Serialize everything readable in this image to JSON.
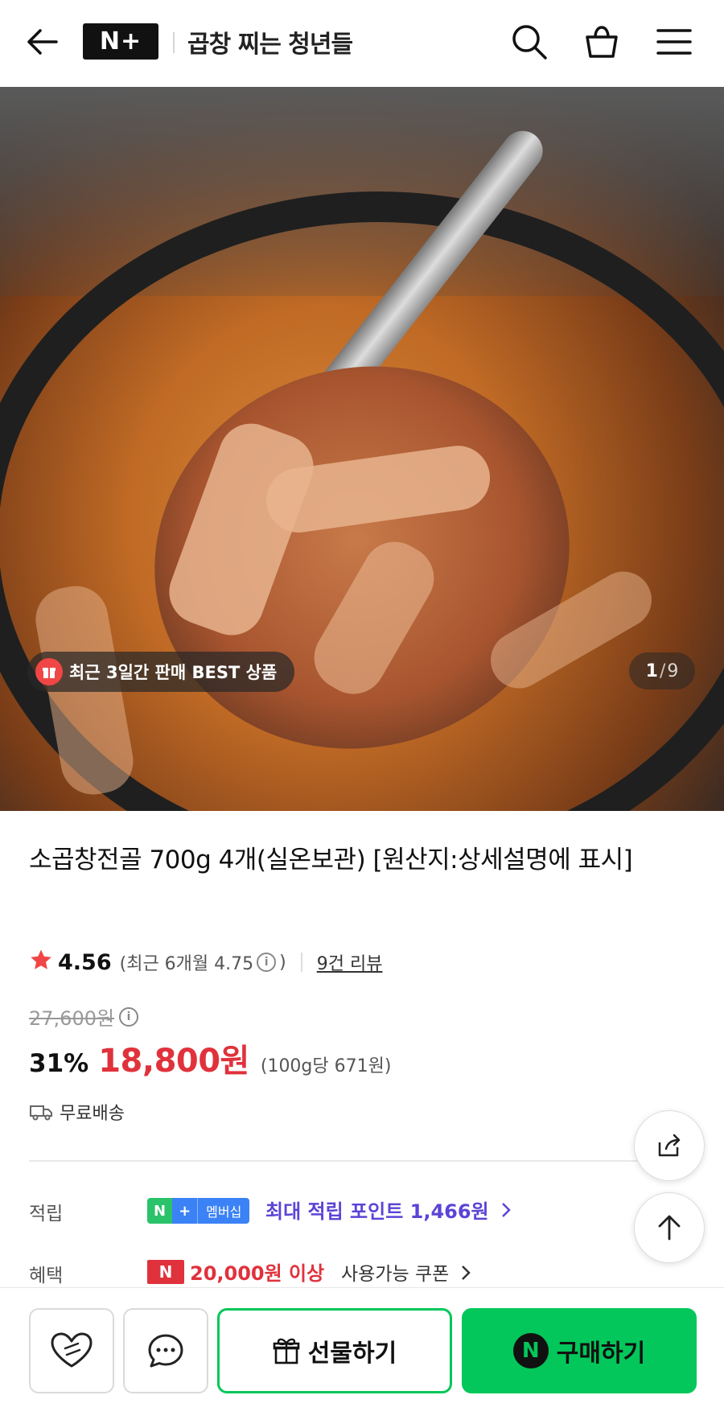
{
  "header": {
    "logo_text": "N+",
    "store_name": "곱창 찌는 청년들",
    "icons": [
      "back-arrow-icon",
      "search-icon",
      "cart-icon",
      "menu-icon"
    ]
  },
  "hero": {
    "badge_text": "최근 3일간 판매 BEST 상품",
    "current_index": "1",
    "separator": "/",
    "total": "9"
  },
  "product": {
    "title": "소곱창전골 700g 4개(실온보관) [원산지:상세설명에 표시]",
    "rating": "4.56",
    "recent_rating": "(최근 6개월 4.75",
    "recent_rating_close": ")",
    "review_link": "9건 리뷰",
    "original_price": "27,600원",
    "discount": "31%",
    "sale_price": "18,800원",
    "unit_price": "(100g당 671원)",
    "shipping": "무료배송"
  },
  "benefits": {
    "points_label": "적립",
    "badge_n": "N",
    "badge_plus": "+",
    "badge_member": "멤버십",
    "max_points": "최대 적립 포인트 1,466원",
    "benefit_label": "혜택",
    "coupon_mark": "N",
    "coupon_amount": "20,000원 이상",
    "coupon_rest": "사용가능 쿠폰"
  },
  "bottom": {
    "gift_label": "선물하기",
    "buy_label": "구매하기",
    "buy_icon_text": "N"
  },
  "colors": {
    "accent_green": "#03c75a",
    "price_red": "#e0323c",
    "point_purple": "#5b44d6"
  }
}
